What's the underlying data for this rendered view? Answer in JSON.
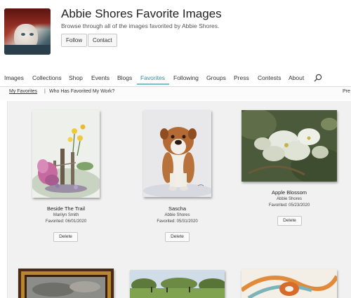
{
  "profile": {
    "name": "Abbie Shores Favorite Images",
    "description": "Browse through all of the images favorited by Abbie Shores.",
    "follow_label": "Follow",
    "contact_label": "Contact"
  },
  "nav": {
    "items": [
      {
        "label": "Images"
      },
      {
        "label": "Collections"
      },
      {
        "label": "Shop"
      },
      {
        "label": "Events"
      },
      {
        "label": "Blogs"
      },
      {
        "label": "Favorites",
        "active": true
      },
      {
        "label": "Following"
      },
      {
        "label": "Groups"
      },
      {
        "label": "Press"
      },
      {
        "label": "Contests"
      },
      {
        "label": "About"
      }
    ],
    "search_icon": "search-icon"
  },
  "subnav": {
    "my_favorites": "My Favorites",
    "separator": "|",
    "who_favorited": "Who Has Favorited My Work?",
    "overflow": "Pre"
  },
  "favorites": [
    {
      "title": "Beside The Trail",
      "artist": "Marilyn Smith",
      "favorited": "Favorited: 06/01/2020",
      "delete_label": "Delete"
    },
    {
      "title": "Sascha",
      "artist": "Abbie Shores",
      "favorited": "Favorited: 05/31/2020",
      "delete_label": "Delete"
    },
    {
      "title": "Apple Blossom",
      "artist": "Abbie Shores",
      "favorited": "Favorited: 05/23/2020",
      "delete_label": "Delete"
    }
  ],
  "colors": {
    "accent": "#2d8fa0",
    "accent_underline": "#6ec4d0",
    "grid_background": "#f1f1f1"
  }
}
